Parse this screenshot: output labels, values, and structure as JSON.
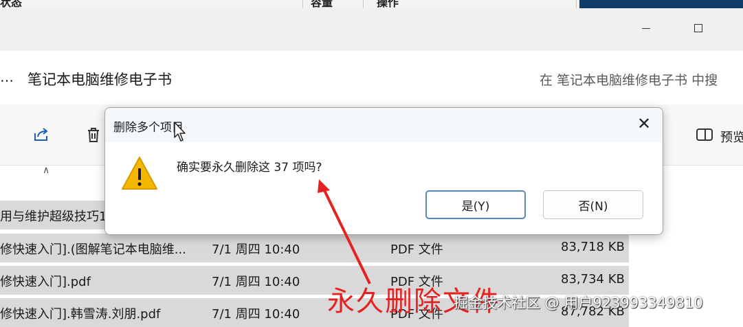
{
  "top_strip": {
    "col1": "状态",
    "col2": "容量",
    "col3": "操作"
  },
  "address": {
    "more": "…",
    "path": "笔记本电脑维修电子书",
    "search_placeholder": "在 笔记本电脑维修电子书 中搜"
  },
  "toolbar": {
    "preview_label": "预览"
  },
  "files": [
    {
      "name": "用与维护超级技巧1",
      "date": "",
      "type": "",
      "size": ""
    },
    {
      "name": "修快速入门].(图解笔记本电脑维...",
      "date": "7/1 周四 10:40",
      "type": "PDF 文件",
      "size": "83,718 KB"
    },
    {
      "name": "修快速入门].pdf",
      "date": "7/1 周四 10:40",
      "type": "PDF 文件",
      "size": "83,734 KB"
    },
    {
      "name": "修快速入门].韩雪涛.刘朋.pdf",
      "date": "7/1 周四 10:40",
      "type": "PDF 文件",
      "size": "87,782 KB"
    }
  ],
  "dialog": {
    "title": "删除多个项目",
    "message": "确实要永久删除这 37 项吗?",
    "yes_label": "是(Y)",
    "no_label": "否(N)"
  },
  "annotation": {
    "text": "永久删除文件",
    "color": "#e52222"
  },
  "watermark": "掘金技术社区 @ 用户923993349810",
  "colors": {
    "accent_blue": "#0f3b66",
    "warning_yellow": "#f5b800",
    "selection_gray": "#d9d9d9"
  }
}
